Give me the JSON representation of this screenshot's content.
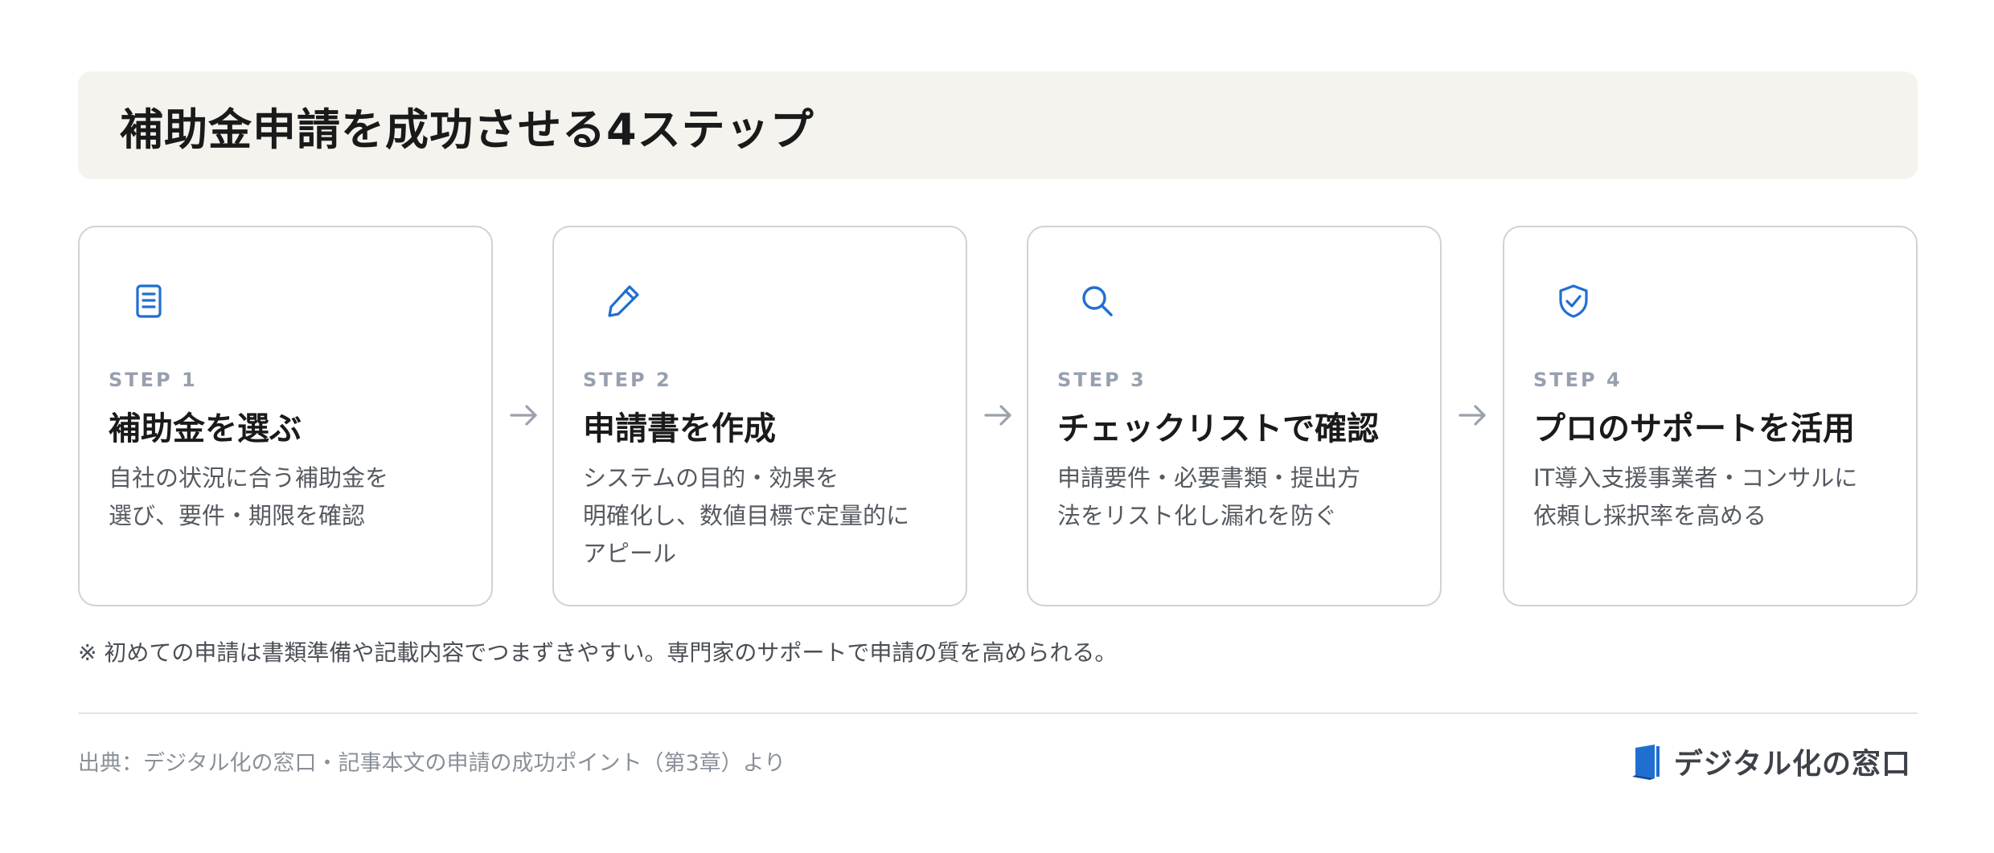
{
  "header": {
    "title": "補助金申請を成功させる4ステップ"
  },
  "colors": {
    "accent": "#1f6fd1",
    "title_bg": "#f5f3ee",
    "step_label": "#97a0ae",
    "card_border": "#cfd2d6"
  },
  "steps": [
    {
      "icon": "document-icon",
      "label": "STEP 1",
      "title": "補助金を選ぶ",
      "desc_lines": [
        "自社の状況に合う補助金を",
        "選び、要件・期限を確認"
      ]
    },
    {
      "icon": "pencil-icon",
      "label": "STEP 2",
      "title": "申請書を作成",
      "desc_lines": [
        "システムの目的・効果を",
        "明確化し、数値目標で定量的に",
        "アピール"
      ]
    },
    {
      "icon": "search-icon",
      "label": "STEP 3",
      "title": "チェックリストで確認",
      "desc_lines": [
        "申請要件・必要書類・提出方",
        "法をリスト化し漏れを防ぐ"
      ]
    },
    {
      "icon": "shield-check-icon",
      "label": "STEP 4",
      "title": "プロのサポートを活用",
      "desc_lines": [
        "IT導入支援事業者・コンサルに",
        "依頼し採択率を高める"
      ]
    }
  ],
  "arrows": [
    "arrow-right-icon",
    "arrow-right-icon",
    "arrow-right-icon"
  ],
  "note": "※ 初めての申請は書類準備や記載内容でつまずきやすい。専門家のサポートで申請の質を高められる。",
  "footer": {
    "source": "出典：デジタル化の窓口・記事本文の申請の成功ポイント（第3章）より",
    "brand_logo_icon": "window-logo-icon",
    "brand_name": "デジタル化の窓口"
  }
}
